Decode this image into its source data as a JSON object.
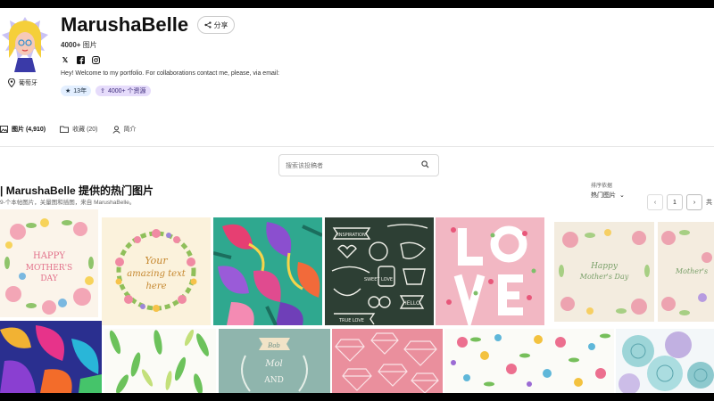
{
  "profile": {
    "name": "MarushaBelle",
    "share_label": "分享",
    "count_value": "4000+",
    "count_unit": "图片",
    "location": "葡萄牙",
    "bio": "Hey! Welcome to my portfolio. For collaborations contact me, please, via email:",
    "badge_years": "13年",
    "badge_assets": "4000+ 个资源"
  },
  "social": [
    "x-icon",
    "facebook-icon",
    "instagram-icon"
  ],
  "tabs": [
    {
      "label": "图片 (4,910)",
      "icon": "image-icon",
      "active": true
    },
    {
      "label": "收藏 (20)",
      "icon": "folder-icon",
      "active": false
    },
    {
      "label": "简介",
      "icon": "user-icon",
      "active": false
    }
  ],
  "search": {
    "placeholder": "搜索该投稿者"
  },
  "section": {
    "title": "| MarushaBelle 提供的热门图片",
    "subtitle": "9-个本帖图片，关量图和插图，来自 MarushaBelle。"
  },
  "sort": {
    "label": "排序依据",
    "value": "热门图片"
  },
  "pager": {
    "page": "1",
    "of": "共"
  },
  "colors": {
    "accent": "#6a3cc7",
    "badge_blue": "#e3efff",
    "badge_purple": "#e6dcfb"
  }
}
